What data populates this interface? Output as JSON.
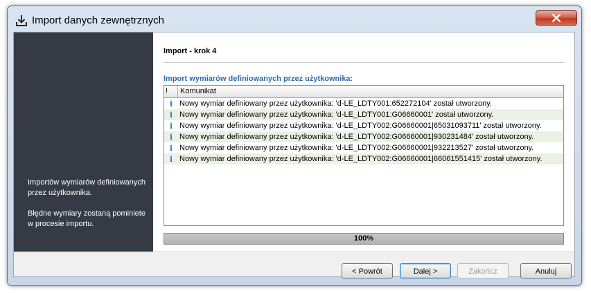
{
  "window": {
    "title": "Import danych zewnętrznych",
    "icons": {
      "title": "download-icon",
      "close": "close-icon"
    }
  },
  "side_panel": {
    "paragraph1": "Importów wymiarów definiowanych przez użytkownika.",
    "paragraph2": "Błędne wymiary zostaną pominiete w procesie importu."
  },
  "content": {
    "step_title": "Import - krok 4",
    "section_title": "Import wymiarów definiowanych przez użytkownika:",
    "list": {
      "columns": {
        "flag": "!",
        "message": "Komunikat"
      },
      "row_icon": "info-icon",
      "rows": [
        {
          "icon_glyph": "i",
          "message": "Nowy wymiar definiowany przez użytkownika: 'd-LE_LDTY001:652272104' został utworzony."
        },
        {
          "icon_glyph": "i",
          "message": "Nowy wymiar definiowany przez użytkownika: 'd-LE_LDTY001:G06660001' został utworzony."
        },
        {
          "icon_glyph": "i",
          "message": "Nowy wymiar definiowany przez użytkownika: 'd-LE_LDTY002:G06660001|65031093711' został utworzony."
        },
        {
          "icon_glyph": "i",
          "message": "Nowy wymiar definiowany przez użytkownika: 'd-LE_LDTY002:G06660001|930231484' został utworzony."
        },
        {
          "icon_glyph": "i",
          "message": "Nowy wymiar definiowany przez użytkownika: 'd-LE_LDTY002:G06660001|932213527' został utworzony."
        },
        {
          "icon_glyph": "i",
          "message": "Nowy wymiar definiowany przez użytkownika: 'd-LE_LDTY002:G06660001|66061551415' został utworzony."
        }
      ]
    },
    "progress": {
      "value": 100,
      "label": "100%"
    }
  },
  "buttons": {
    "back": "< Powrót",
    "next": "Dalej >",
    "finish": "Zakończ",
    "cancel": "Anuluj"
  },
  "colors": {
    "side_panel_bg": "#363a44",
    "section_title": "#2b6cb0",
    "info_icon": "#2a78c8",
    "alt_row": "#eaf1e5"
  }
}
